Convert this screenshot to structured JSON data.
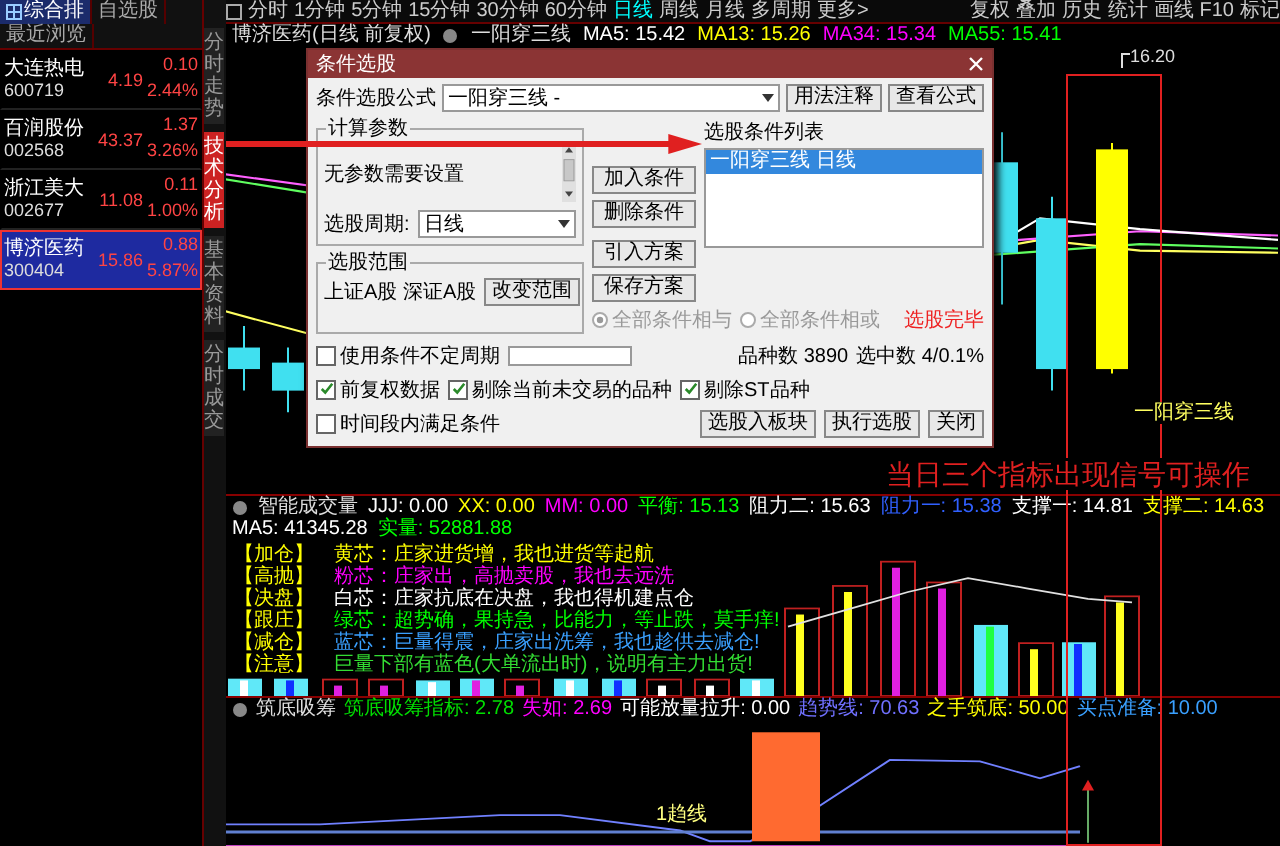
{
  "sidebar": {
    "header_tabs": [
      {
        "label": "综合排",
        "selected": true
      },
      {
        "label": "自选股",
        "selected": false
      },
      {
        "label": "最近浏览",
        "selected": false
      }
    ],
    "stocks": [
      {
        "name": "大连热电",
        "code": "600719",
        "price": "4.19",
        "change": "0.10",
        "pct": "2.44%",
        "selected": false
      },
      {
        "name": "百润股份",
        "code": "002568",
        "price": "43.37",
        "change": "1.37",
        "pct": "3.26%",
        "selected": false
      },
      {
        "name": "浙江美大",
        "code": "002677",
        "price": "11.08",
        "change": "0.11",
        "pct": "1.00%",
        "selected": false
      },
      {
        "name": "博济医药",
        "code": "300404",
        "price": "15.86",
        "change": "0.88",
        "pct": "5.87%",
        "selected": true
      }
    ]
  },
  "side_tabs": [
    {
      "label": "分时走势",
      "selected": false
    },
    {
      "label": "技术分析",
      "selected": true
    },
    {
      "label": "基本资料",
      "selected": false
    },
    {
      "label": "分时成交",
      "selected": false
    }
  ],
  "toolbar": {
    "periods": [
      {
        "label": "分时",
        "selected": false
      },
      {
        "label": "1分钟",
        "selected": false
      },
      {
        "label": "5分钟",
        "selected": false
      },
      {
        "label": "15分钟",
        "selected": false
      },
      {
        "label": "30分钟",
        "selected": false
      },
      {
        "label": "60分钟",
        "selected": false
      },
      {
        "label": "日线",
        "selected": true
      },
      {
        "label": "周线",
        "selected": false
      },
      {
        "label": "月线",
        "selected": false
      },
      {
        "label": "多周期",
        "selected": false
      },
      {
        "label": "更多>",
        "selected": false
      }
    ],
    "actions": [
      "复权",
      "叠加",
      "历史",
      "统计",
      "画线",
      "F10",
      "标记"
    ]
  },
  "chart": {
    "title": "博济医药(日线 前复权)",
    "formula": "一阳穿三线",
    "ma": [
      {
        "label": "MA5: 15.42",
        "color": "#ffffff"
      },
      {
        "label": "MA13: 15.26",
        "color": "#ffff00"
      },
      {
        "label": "MA34: 15.34",
        "color": "#ff00ff"
      },
      {
        "label": "MA55: 15.41",
        "color": "#00ff00"
      }
    ],
    "price_label": "16.20",
    "signal_label": "一阳穿三线",
    "annotation": "当日三个指标出现信号可操作"
  },
  "dialog": {
    "title": "条件选股",
    "formula_label": "条件选股公式",
    "formula_value": "一阳穿三线  -",
    "top_buttons": [
      "用法注释",
      "查看公式"
    ],
    "params_title": "计算参数",
    "params_text": "无参数需要设置",
    "period_label": "选股周期:",
    "period_value": "日线",
    "range_title": "选股范围",
    "range_text": "上证A股 深证A股",
    "range_button": "改变范围",
    "middle_buttons": [
      "加入条件",
      "删除条件",
      "引入方案",
      "保存方案"
    ],
    "list_title": "选股条件列表",
    "conditions": [
      {
        "text": "一阳穿三线  日线",
        "selected": true
      }
    ],
    "logic": [
      {
        "label": "全部条件相与",
        "selected": true
      },
      {
        "label": "全部条件相或",
        "selected": false
      }
    ],
    "status": "选股完毕",
    "period_option": {
      "label": "使用条件不定周期",
      "checked": false
    },
    "progress": {
      "level": 0
    },
    "counts": [
      "品种数 3890",
      "选中数 4/0.1%"
    ],
    "options": [
      {
        "label": "前复权数据",
        "checked": true
      },
      {
        "label": "剔除当前未交易的品种",
        "checked": true
      },
      {
        "label": "剔除ST品种",
        "checked": true
      }
    ],
    "time_option": {
      "label": "时间段内满足条件",
      "checked": false
    },
    "bottom_buttons": [
      "选股入板块",
      "执行选股"
    ],
    "close_button": "关闭"
  },
  "volume_panel": {
    "title": "智能成交量",
    "values": [
      {
        "label": "JJJ: 0.00",
        "color": "#ffffff"
      },
      {
        "label": "XX: 0.00",
        "color": "#ffff00"
      },
      {
        "label": "MM: 0.00",
        "color": "#ff00ff"
      },
      {
        "label": "平衡: 15.13",
        "color": "#00ff00"
      },
      {
        "label": "阻力二: 15.63",
        "color": "#ffffff"
      },
      {
        "label": "阻力一: 15.38",
        "color": "#3060ff"
      },
      {
        "label": "支撑一: 14.81",
        "color": "#ffffff"
      },
      {
        "label": "支撑二: 14.63",
        "color": "#ffff00"
      },
      {
        "label": "MA5: 41345.28",
        "color": "#ffffff"
      },
      {
        "label": "实量: 52881.88",
        "color": "#00ff00"
      }
    ],
    "legend": [
      {
        "tag": "【加仓】",
        "text": "黄芯：庄家进货增，我也进货等起航",
        "color": "#ffff00"
      },
      {
        "tag": "【高抛】",
        "text": "粉芯：庄家出，高抛卖股，我也去远洗",
        "color": "#ff00ff"
      },
      {
        "tag": "【决盘】",
        "text": "白芯：庄家抗底在决盘，我也得机建点仓",
        "color": "#ffffff"
      },
      {
        "tag": "【跟庄】",
        "text": "绿芯：超势确，果持急，比能力，等止跌，莫手痒!",
        "color": "#00ff00"
      },
      {
        "tag": "【减仓】",
        "text": "蓝芯：巨量得震，庄家出洗筹，我也趁供去减仓!",
        "color": "#3aa0ff"
      },
      {
        "tag": "【注意】",
        "text": "巨量下部有蓝色(大单流出时)，说明有主力出货!",
        "color": "#33dd33"
      }
    ]
  },
  "bottom_panel": {
    "title": "筑底吸筹",
    "values": [
      {
        "label": "筑底吸筹指标: 2.78",
        "color": "#00dd00"
      },
      {
        "label": "失如: 2.69",
        "color": "#ff00ff"
      },
      {
        "label": "可能放量拉升: 0.00",
        "color": "#ffffff"
      },
      {
        "label": "趋势线: 70.63",
        "color": "#7070ff"
      },
      {
        "label": "之手筑底: 50.00",
        "color": "#ffff00"
      },
      {
        "label": "买点准备: 10.00",
        "color": "#3aa0ff"
      }
    ],
    "line_label": "1趋线"
  }
}
